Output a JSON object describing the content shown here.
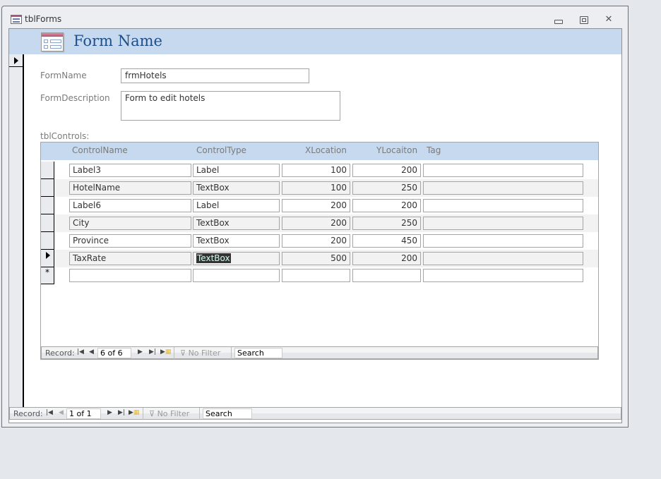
{
  "window": {
    "title": "tblForms",
    "buttons": {
      "minimize": "minimize",
      "maximize": "restore",
      "close": "close"
    }
  },
  "form": {
    "title": "Form Name",
    "fields": {
      "form_name": {
        "label": "FormName",
        "value": "frmHotels"
      },
      "form_description": {
        "label": "FormDescription",
        "value": "Form to edit hotels"
      }
    },
    "subform_label": "tblControls:"
  },
  "subform": {
    "columns": [
      "ControlName",
      "ControlType",
      "XLocation",
      "YLocaiton",
      "Tag"
    ],
    "rows": [
      {
        "ControlName": "Label3",
        "ControlType": "Label",
        "XLocation": "100",
        "YLocation": "200",
        "Tag": ""
      },
      {
        "ControlName": "HotelName",
        "ControlType": "TextBox",
        "XLocation": "100",
        "YLocation": "250",
        "Tag": ""
      },
      {
        "ControlName": "Label6",
        "ControlType": "Label",
        "XLocation": "200",
        "YLocation": "200",
        "Tag": ""
      },
      {
        "ControlName": "City",
        "ControlType": "TextBox",
        "XLocation": "200",
        "YLocation": "250",
        "Tag": ""
      },
      {
        "ControlName": "Province",
        "ControlType": "TextBox",
        "XLocation": "200",
        "YLocation": "450",
        "Tag": ""
      },
      {
        "ControlName": "TaxRate",
        "ControlType": "TextBox",
        "XLocation": "500",
        "YLocation": "200",
        "Tag": ""
      }
    ],
    "current_row": 6,
    "new_row_marker": "*",
    "nav": {
      "record_label": "Record:",
      "position": "6 of 6",
      "filter_label": "No Filter",
      "search_value": "Search"
    }
  },
  "main_nav": {
    "record_label": "Record:",
    "position": "1 of 1",
    "filter_label": "No Filter",
    "search_value": "Search"
  },
  "icons": {
    "first": "⏮",
    "prev": "◀",
    "next": "▶",
    "last": "⏭",
    "new": "▶*",
    "filter": "funnel-x-icon"
  }
}
